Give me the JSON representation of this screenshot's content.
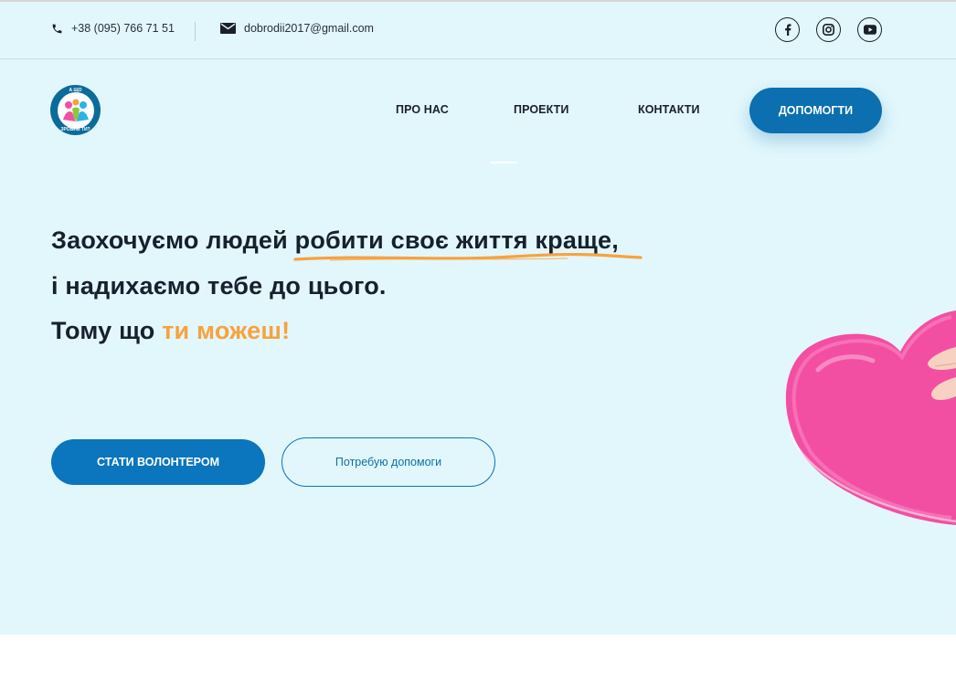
{
  "topbar": {
    "phone": "+38 (095) 766 71 51",
    "email": "dobrodii2017@gmail.com",
    "socials": [
      "facebook-icon",
      "instagram-icon",
      "youtube-icon"
    ]
  },
  "logo": {
    "top_text": "А ЩО",
    "bottom_text": "ЗРОБИВ ТИ?"
  },
  "nav": {
    "about": "ПРО НАС",
    "projects": "ПРОЕКТИ",
    "contacts": "КОНТАКТИ",
    "help_button": "ДОПОМОГТИ"
  },
  "hero": {
    "line1_start": "Заохочуємо людей ",
    "line1_highlight": "робити своє життя краще,",
    "line2": "і надихаємо тебе до цього.",
    "line3_start": "Тому що ",
    "line3_accent": "ти можеш!",
    "volunteer_button": "СТАТИ ВОЛОНТЕРОМ",
    "need_help_button": "Потребую допомоги"
  },
  "colors": {
    "background": "#e2f7fc",
    "primary": "#0b6fb0",
    "accent": "#f7a23e",
    "heart": "#f24fa3"
  }
}
